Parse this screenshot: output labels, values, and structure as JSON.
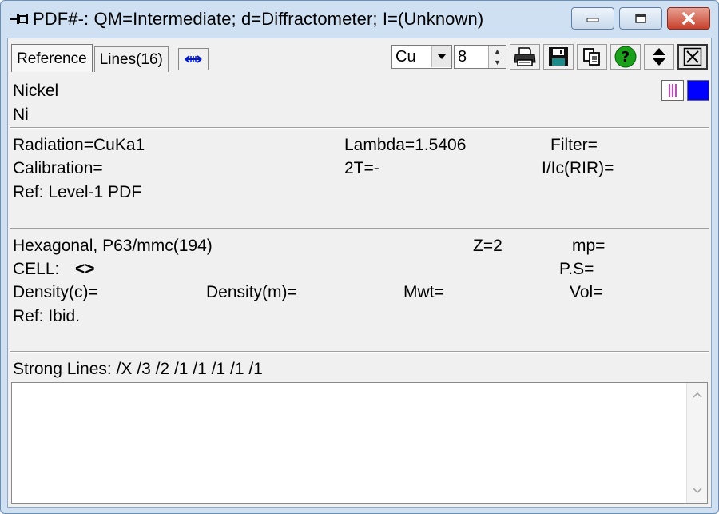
{
  "window": {
    "title": "PDF#-: QM=Intermediate; d=Diffractometer; I=(Unknown)"
  },
  "tabs": [
    {
      "label": "Reference",
      "active": true
    },
    {
      "label": "Lines(16)",
      "active": false
    }
  ],
  "toolbar": {
    "radiation_select": "Cu",
    "digits_value": "8"
  },
  "substance": {
    "name": "Nickel",
    "formula": "Ni"
  },
  "experimental": {
    "radiation": "Radiation=CuKa1",
    "lambda": "Lambda=1.5406",
    "filter": "Filter=",
    "calibration": "Calibration=",
    "two_theta": "2T=-",
    "i_ic": "I/Ic(RIR)=",
    "ref": "Ref: Level-1 PDF"
  },
  "crystal": {
    "system": "Hexagonal,  P63/mmc(194)",
    "z": "Z=2",
    "mp": "mp=",
    "cell_label": "CELL:",
    "cell_value": "<>",
    "ps": "P.S=",
    "density_c": "Density(c)=",
    "density_m": "Density(m)=",
    "mwt": "Mwt=",
    "vol": "Vol=",
    "ref": "Ref: Ibid."
  },
  "strong_lines": "Strong Lines: /X /3 /2 /1 /1 /1 /1 /1",
  "colors": {
    "marker_color": "#c000c0",
    "swatch_color": "#0000ff",
    "help_green": "#1aa01a"
  }
}
